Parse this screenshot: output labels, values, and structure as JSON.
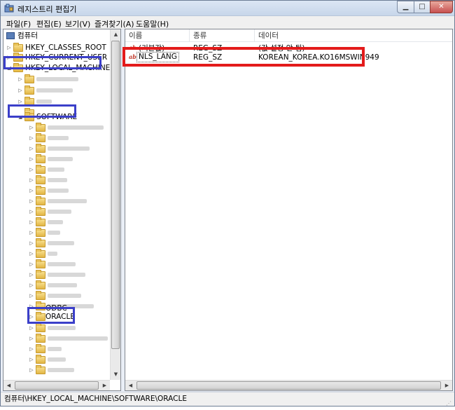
{
  "window": {
    "title": "레지스트리 편집기"
  },
  "menu": [
    "파일(F)",
    "편집(E)",
    "보기(V)",
    "즐겨찾기(A)",
    "도움말(H)"
  ],
  "tree": {
    "root": "컴퓨터",
    "keys": {
      "classes_root": "HKEY_CLASSES_ROOT",
      "current_user": "HKEY_CURRENT_USER",
      "local_machine": "HKEY_LOCAL_MACHINE",
      "software": "SOFTWARE",
      "odbc": "ODBC",
      "oracle": "ORACLE"
    }
  },
  "list": {
    "headers": {
      "name": "이름",
      "type": "종류",
      "data": "데이터"
    },
    "rows": [
      {
        "name": "(기본값)",
        "type": "REG_SZ",
        "data": "(값 설정 안 됨)"
      },
      {
        "name": "NLS_LANG",
        "type": "REG_SZ",
        "data": "KOREAN_KOREA.KO16MSWIN949"
      }
    ]
  },
  "status": {
    "path": "컴퓨터\\HKEY_LOCAL_MACHINE\\SOFTWARE\\ORACLE"
  },
  "colors": {
    "highlight_blue": "#3b3fc9",
    "highlight_red": "#e31b1b"
  }
}
